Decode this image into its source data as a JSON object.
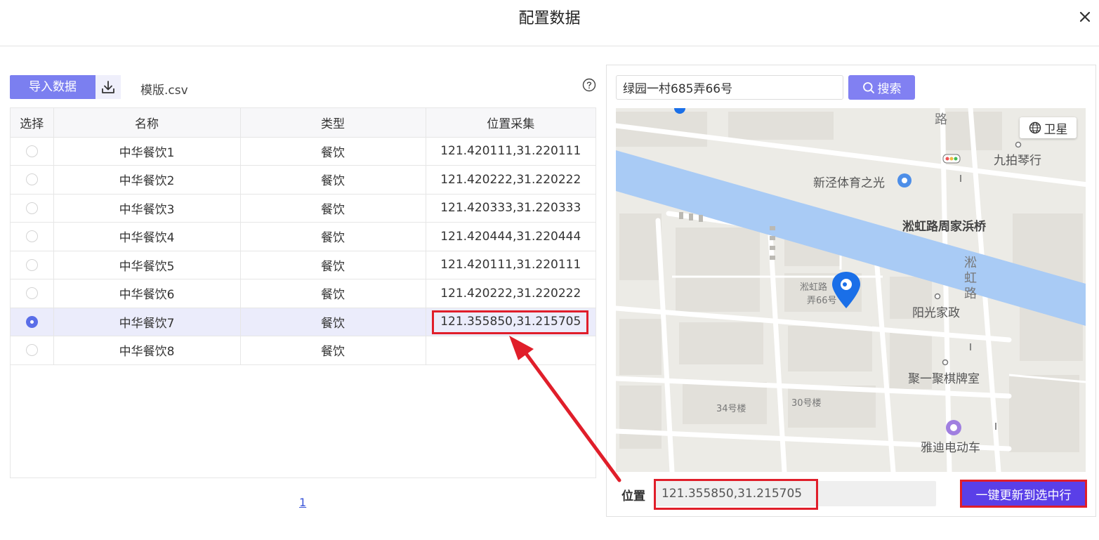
{
  "modal": {
    "title": "配置数据"
  },
  "toolbar": {
    "import_label": "导入数据",
    "template_label": "模版.csv"
  },
  "table": {
    "columns": [
      "选择",
      "名称",
      "类型",
      "位置采集"
    ],
    "rows": [
      {
        "selected": false,
        "name": "中华餐饮1",
        "type": "餐饮",
        "location": "121.420111,31.220111"
      },
      {
        "selected": false,
        "name": "中华餐饮2",
        "type": "餐饮",
        "location": "121.420222,31.220222"
      },
      {
        "selected": false,
        "name": "中华餐饮3",
        "type": "餐饮",
        "location": "121.420333,31.220333"
      },
      {
        "selected": false,
        "name": "中华餐饮4",
        "type": "餐饮",
        "location": "121.420444,31.220444"
      },
      {
        "selected": false,
        "name": "中华餐饮5",
        "type": "餐饮",
        "location": "121.420111,31.220111"
      },
      {
        "selected": false,
        "name": "中华餐饮6",
        "type": "餐饮",
        "location": "121.420222,31.220222"
      },
      {
        "selected": true,
        "name": "中华餐饮7",
        "type": "餐饮",
        "location": "121.355850,31.215705"
      },
      {
        "selected": false,
        "name": "中华餐饮8",
        "type": "餐饮",
        "location": ""
      }
    ]
  },
  "pagination": {
    "current": "1"
  },
  "search": {
    "value": "绿园一村685弄66号",
    "button_label": "搜索"
  },
  "map": {
    "satellite_label": "卫星",
    "labels": {
      "poi_sports": "新泾体育之光",
      "bridge": "淞虹路周家浜桥",
      "road_top": "路",
      "road_side_1": "淞",
      "road_side_2": "虹",
      "road_side_3": "路",
      "piano": "九拍琴行",
      "housekeeping": "阳光家政",
      "chess": "聚一聚棋牌室",
      "bldg_34": "34号楼",
      "bldg_30": "30号楼",
      "ebike": "雅迪电动车",
      "addr_1": "淞虹路",
      "addr_2": "弄66号"
    }
  },
  "position": {
    "label": "位置",
    "value": "121.355850,31.215705"
  },
  "update_button": {
    "label": "一键更新到选中行"
  },
  "colors": {
    "primary": "#7b7ff0",
    "highlight": "#e01e2a",
    "update_button": "#5a3fe8",
    "pin": "#1a6fe8",
    "river": "#a9cbf5"
  }
}
